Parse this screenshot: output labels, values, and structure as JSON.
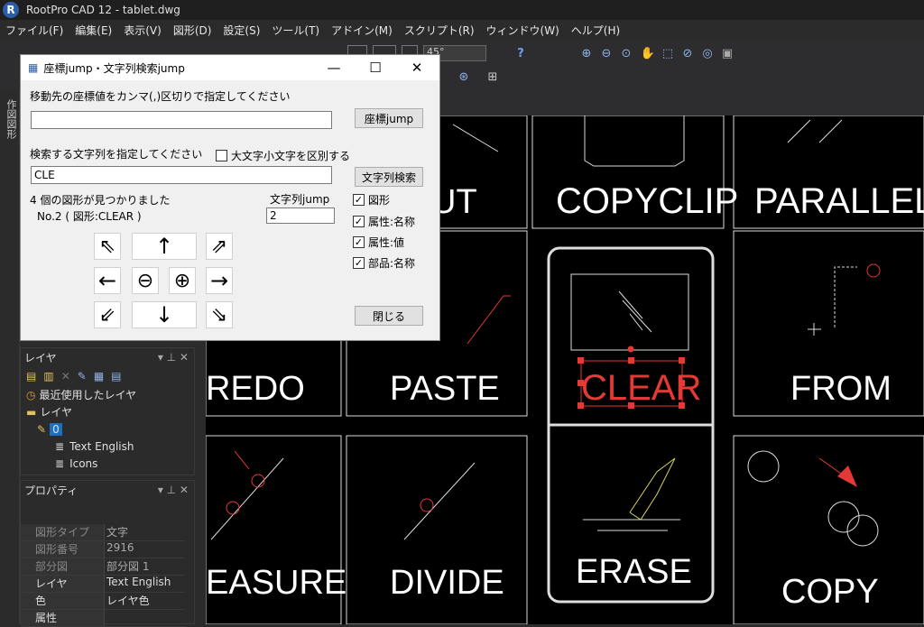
{
  "app": {
    "title": "RootPro CAD 12 - tablet.dwg",
    "icon": "R"
  },
  "menu": [
    "ファイル(F)",
    "編集(E)",
    "表示(V)",
    "図形(D)",
    "設定(S)",
    "ツール(T)",
    "アドイン(M)",
    "スクリプト(R)",
    "ウィンドウ(W)",
    "ヘルプ(H)"
  ],
  "toolbar": {
    "angle": "45°"
  },
  "side_tab": "作図図形",
  "dialog": {
    "title": "座標jump・文字列検索jump",
    "coord_label": "移動先の座標値をカンマ(,)区切りで指定してください",
    "coord_value": "",
    "coord_button": "座標jump",
    "search_label": "検索する文字列を指定してください",
    "case_label": "大文字小文字を区別する",
    "search_value": "CLE",
    "search_button": "文字列検索",
    "found_text": "4 個の図形が見つかりました",
    "current_text": "No.2 ( 図形:CLEAR )",
    "jump_label": "文字列jump",
    "jump_value": "2",
    "options": [
      {
        "label": "図形",
        "checked": true
      },
      {
        "label": "属性:名称",
        "checked": true
      },
      {
        "label": "属性:値",
        "checked": true
      },
      {
        "label": "部品:名称",
        "checked": true
      }
    ],
    "close_button": "閉じる"
  },
  "layer_panel": {
    "title": "レイヤ",
    "items": [
      "最近使用したレイヤ",
      "レイヤ",
      "0",
      "Text English",
      "Icons"
    ]
  },
  "property_panel": {
    "title": "プロパティ",
    "rows": [
      [
        "図形タイプ",
        "文字"
      ],
      [
        "図形番号",
        "2916"
      ],
      [
        "部分図",
        "部分図 1"
      ],
      [
        "レイヤ",
        "Text English"
      ],
      [
        "色",
        "レイヤ色"
      ],
      [
        "属性",
        ""
      ]
    ]
  },
  "canvas": {
    "labels": [
      "UT",
      "COPYCLIP",
      "PARALLEL",
      "REDO",
      "PASTE",
      "CLEAR",
      "FROM",
      "EASURE",
      "DIVIDE",
      "ERASE",
      "COPY"
    ],
    "highlight_color": "#e53935"
  }
}
